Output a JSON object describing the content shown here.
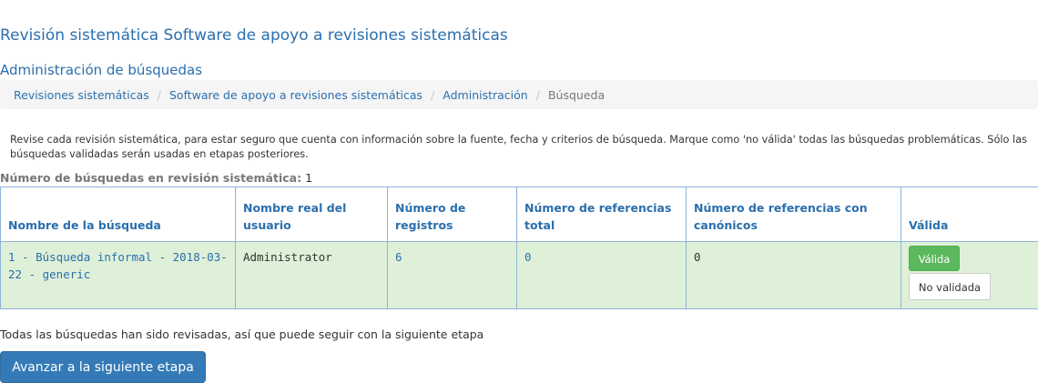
{
  "page": {
    "title": "Revisión sistemática Software de apoyo a revisiones sistemáticas",
    "section_title": "Administración de búsquedas"
  },
  "breadcrumb": {
    "items": [
      "Revisiones sistemáticas",
      "Software de apoyo a revisiones sistemáticas",
      "Administración"
    ],
    "current": "Búsqueda",
    "separator": "/"
  },
  "instructions": "Revise cada revisión sistemática, para estar seguro que cuenta con información sobre la fuente, fecha y criterios de búsqueda. Marque como 'no válida' todas las búsquedas problemáticas. Sólo las búsquedas validadas serán usadas en etapas posteriores.",
  "count": {
    "label": "Número de búsquedas en revisión sistemática:",
    "value": "1"
  },
  "table": {
    "headers": [
      "Nombre de la búsqueda",
      "Nombre real del usuario",
      "Número de registros",
      "Número de referencias total",
      "Número de referencias con canónicos",
      "Válida"
    ],
    "rows": [
      {
        "search_name": "1 - Búsqueda informal - 2018-03-22 - generic",
        "user_real_name": "Administrator",
        "records": "6",
        "references_total": "0",
        "references_canonical": "0",
        "valid_button": "Válida",
        "not_valid_button": "No validada"
      }
    ]
  },
  "status_message": "Todas las búsquedas han sido revisadas, así que puede seguir con la siguiente etapa",
  "advance_button": "Avanzar a la siguiente etapa",
  "colors": {
    "link": "#2a6fad",
    "row_success_bg": "#dff0d8",
    "btn_success": "#5cb85c",
    "btn_primary": "#337ab7",
    "breadcrumb_bg": "#f5f5f5"
  }
}
